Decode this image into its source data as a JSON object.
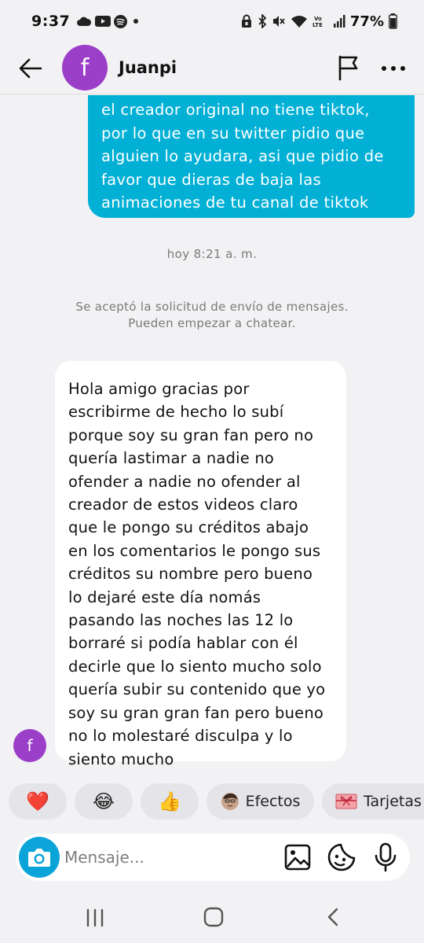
{
  "status_bar": {
    "time": "9:37",
    "battery": "77%",
    "left_icons": [
      "cloud-icon",
      "youtube-icon",
      "spotify-icon",
      "dot-icon"
    ],
    "right_icons": [
      "vpn-lock-icon",
      "bluetooth-icon",
      "mute-icon",
      "wifi-icon",
      "volte-icon",
      "signal-icon",
      "battery-icon"
    ]
  },
  "header": {
    "avatar_letter": "f",
    "contact_name": "Juanpi"
  },
  "messages": {
    "outgoing_text": "el creador original no tiene tiktok,\npor lo que en su twitter pidio que\nalguien lo ayudara, asi que pidio de\nfavor que dieras de baja las\nanimaciones de tu canal de tiktok",
    "timestamp": "hoy 8:21 a. m.",
    "system_note": "Se aceptó la solicitud de envío de mensajes.\nPueden empezar a chatear.",
    "incoming_text": "Hola amigo gracias por\nescribirme de hecho lo subí\nporque soy su gran fan pero no\nquería lastimar a nadie no\nofender a nadie no ofender al\ncreador de estos videos claro\nque le pongo su créditos abajo\nen los comentarios le pongo sus\ncréditos su nombre pero bueno\nlo dejaré este día nomás\npasando las noches las 12 lo\nborraré si podía hablar con él\ndecirle que lo siento mucho solo\nquería subir su contenido que yo\nsoy su gran gran fan pero bueno\nno lo molestaré disculpa y lo\nsiento mucho",
    "incoming_avatar_letter": "f"
  },
  "quick_actions": {
    "heart": "❤️",
    "laugh": "😂",
    "thumbs_up": "👍",
    "effects_label": "Efectos",
    "cards_label": "Tarjetas"
  },
  "composer": {
    "placeholder": "Mensaje...",
    "value": ""
  },
  "colors": {
    "outgoing_bubble": "#02b0d6",
    "incoming_bubble": "#ffffff",
    "avatar": "#9b3fc8",
    "camera_button": "#0aa4d9",
    "background": "#f2f2f4"
  }
}
